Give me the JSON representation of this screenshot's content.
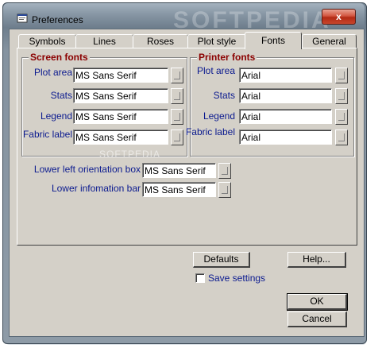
{
  "window": {
    "title": "Preferences",
    "close_label": "x",
    "watermark": "SOFTPEDIA"
  },
  "tabs": [
    {
      "label": "Symbols"
    },
    {
      "label": "Lines"
    },
    {
      "label": "Roses"
    },
    {
      "label": "Plot style"
    },
    {
      "label": "Fonts"
    },
    {
      "label": "General"
    }
  ],
  "active_tab": "Fonts",
  "screen_fonts": {
    "title": "Screen fonts",
    "rows": [
      {
        "label": "Plot area",
        "value": "MS Sans Serif"
      },
      {
        "label": "Stats",
        "value": "MS Sans Serif"
      },
      {
        "label": "Legend",
        "value": "MS Sans Serif"
      },
      {
        "label": "Fabric label",
        "value": "MS Sans Serif"
      }
    ]
  },
  "printer_fonts": {
    "title": "Printer fonts",
    "rows": [
      {
        "label": "Plot area",
        "value": "Arial"
      },
      {
        "label": "Stats",
        "value": "Arial"
      },
      {
        "label": "Legend",
        "value": "Arial"
      },
      {
        "label": "Fabric label",
        "value": "Arial"
      }
    ]
  },
  "extra_fonts": [
    {
      "label": "Lower left orientation box",
      "value": "MS Sans Serif"
    },
    {
      "label": "Lower infomation bar",
      "value": "MS Sans Serif"
    }
  ],
  "buttons": {
    "defaults": "Defaults",
    "help": "Help...",
    "ok": "OK",
    "cancel": "Cancel"
  },
  "save_settings": {
    "label": "Save settings",
    "checked": false
  },
  "softpedia_mark": "SOFTPEDIA"
}
